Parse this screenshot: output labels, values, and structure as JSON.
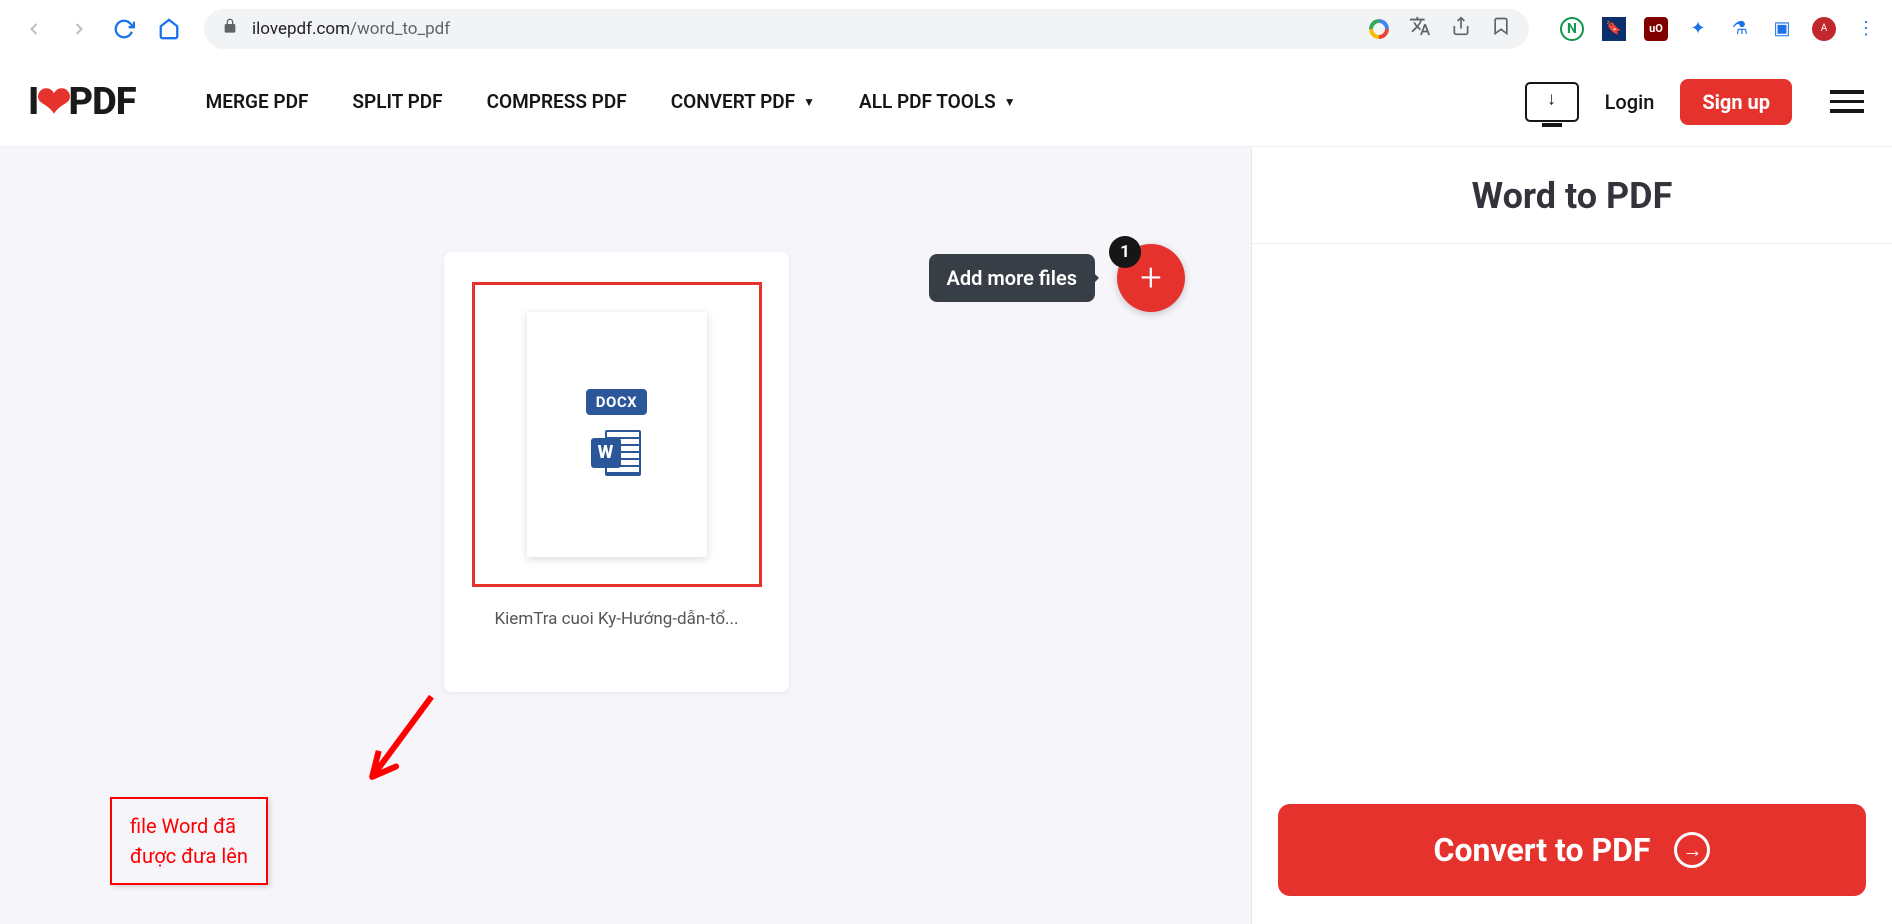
{
  "browser": {
    "url_domain": "ilovepdf.com",
    "url_path": "/word_to_pdf"
  },
  "header": {
    "logo_prefix": "I",
    "logo_suffix": "PDF",
    "nav": {
      "merge": "MERGE PDF",
      "split": "SPLIT PDF",
      "compress": "COMPRESS PDF",
      "convert": "CONVERT PDF",
      "all_tools": "ALL PDF TOOLS"
    },
    "login": "Login",
    "signup": "Sign up"
  },
  "workarea": {
    "add_more_tooltip": "Add more files",
    "badge_count": "1",
    "file": {
      "tag": "DOCX",
      "letter": "W",
      "name": "KiemTra cuoi Ky-Hướng-dẫn-tổ..."
    },
    "annotation_line1": "file Word đã",
    "annotation_line2": "được đưa lên"
  },
  "panel": {
    "title": "Word to PDF",
    "convert": "Convert to PDF"
  }
}
